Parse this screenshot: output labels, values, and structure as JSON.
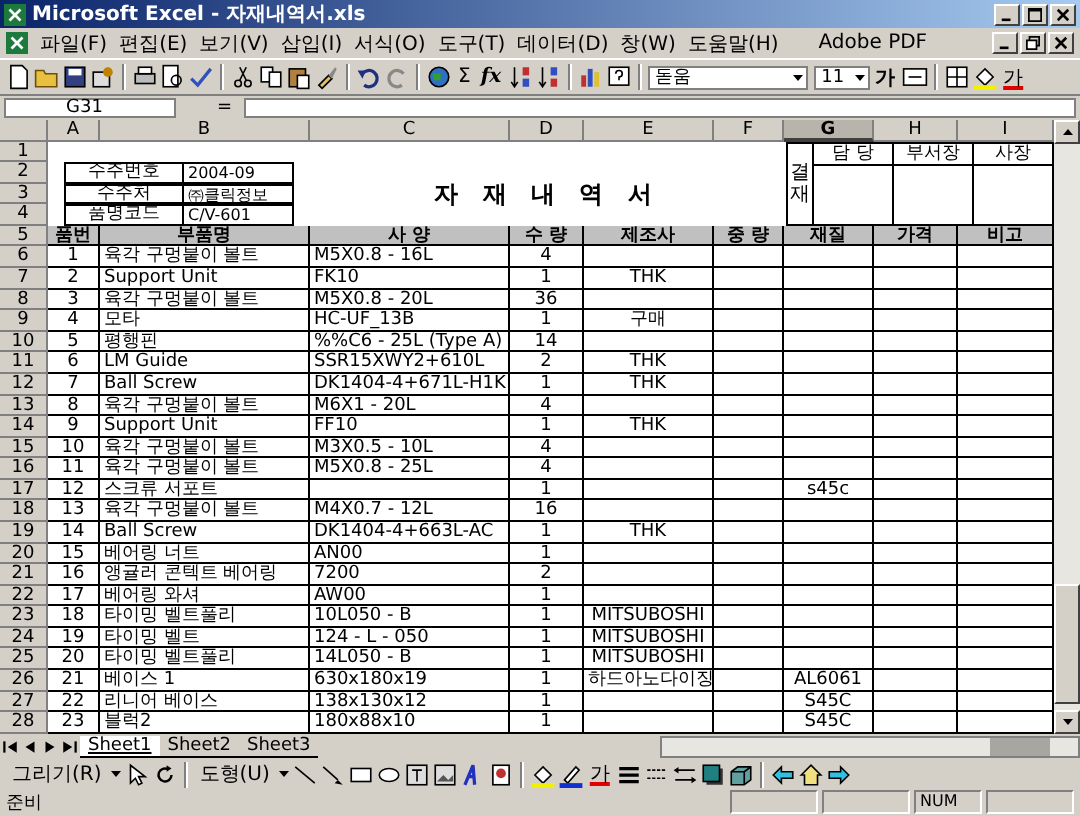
{
  "window": {
    "title": "Microsoft Excel - 자재내역서.xls"
  },
  "menu": [
    "파일(F)",
    "편집(E)",
    "보기(V)",
    "삽입(I)",
    "서식(O)",
    "도구(T)",
    "데이터(D)",
    "창(W)",
    "도움말(H)",
    "Adobe PDF"
  ],
  "toolbar": {
    "sum": "Σ",
    "function": "fx",
    "font": "돋움",
    "size": "11",
    "bold": "가",
    "font_color": "가"
  },
  "formula_bar": {
    "name_box": "G31",
    "equals": "="
  },
  "columns": [
    {
      "label": "A",
      "selected": false
    },
    {
      "label": "B",
      "selected": false
    },
    {
      "label": "C",
      "selected": false
    },
    {
      "label": "D",
      "selected": false
    },
    {
      "label": "E",
      "selected": false
    },
    {
      "label": "F",
      "selected": false
    },
    {
      "label": "G",
      "selected": true
    },
    {
      "label": "H",
      "selected": false
    },
    {
      "label": "I",
      "selected": false
    }
  ],
  "row_headers": [
    "1",
    "2",
    "3",
    "4",
    "5",
    "6",
    "7",
    "8",
    "9",
    "10",
    "11",
    "12",
    "13",
    "14",
    "15",
    "16",
    "17",
    "18",
    "19",
    "20",
    "21",
    "22",
    "23",
    "24",
    "25",
    "26",
    "27",
    "28"
  ],
  "header_block": {
    "fields": [
      {
        "label": "수주번호",
        "value": "2004-09"
      },
      {
        "label": "수주처",
        "value": "㈜클릭정보"
      },
      {
        "label": "품명코드",
        "value": "C/V-601"
      }
    ],
    "title": "자 재 내 역 서",
    "approval": {
      "label": "결재",
      "roles": [
        "담 당",
        "부서장",
        "사장"
      ]
    }
  },
  "table": {
    "columns": [
      "품번",
      "부품명",
      "사 양",
      "수 량",
      "제조사",
      "중 량",
      "재질",
      "가격",
      "비고"
    ],
    "rows": [
      {
        "no": "1",
        "part": "육각 구멍붙이 볼트",
        "spec": "M5X0.8 - 16L",
        "qty": "4"
      },
      {
        "no": "2",
        "part": "Support Unit",
        "spec": "FK10",
        "qty": "1",
        "maker": "THK"
      },
      {
        "no": "3",
        "part": "육각 구멍붙이 볼트",
        "spec": "M5X0.8 - 20L",
        "qty": "36"
      },
      {
        "no": "4",
        "part": "모타",
        "spec": "HC-UF_13B",
        "qty": "1",
        "maker": "구매"
      },
      {
        "no": "5",
        "part": "평행핀",
        "spec": "%%C6 - 25L (Type A)",
        "qty": "14"
      },
      {
        "no": "6",
        "part": "LM Guide",
        "spec": "SSR15XWY2+610L",
        "qty": "2",
        "maker": "THK"
      },
      {
        "no": "7",
        "part": "Ball Screw",
        "spec": "DK1404-4+671L-H1K",
        "qty": "1",
        "maker": "THK"
      },
      {
        "no": "8",
        "part": "육각 구멍붙이 볼트",
        "spec": "M6X1 - 20L",
        "qty": "4"
      },
      {
        "no": "9",
        "part": "Support Unit",
        "spec": "FF10",
        "qty": "1",
        "maker": "THK"
      },
      {
        "no": "10",
        "part": "육각 구멍붙이 볼트",
        "spec": "M3X0.5 - 10L",
        "qty": "4"
      },
      {
        "no": "11",
        "part": "육각 구멍붙이 볼트",
        "spec": "M5X0.8 - 25L",
        "qty": "4"
      },
      {
        "no": "12",
        "part": "스크류 서포트",
        "qty": "1",
        "material": "s45c"
      },
      {
        "no": "13",
        "part": "육각 구멍붙이 볼트",
        "spec": "M4X0.7 - 12L",
        "qty": "16"
      },
      {
        "no": "14",
        "part": "Ball Screw",
        "spec": "DK1404-4+663L-AC",
        "qty": "1",
        "maker": "THK"
      },
      {
        "no": "15",
        "part": "베어링 너트",
        "spec": "AN00",
        "qty": "1"
      },
      {
        "no": "16",
        "part": "앵귤러 콘텍트 베어링",
        "spec": "7200",
        "qty": "2"
      },
      {
        "no": "17",
        "part": "베어링 와셔",
        "spec": "AW00",
        "qty": "1"
      },
      {
        "no": "18",
        "part": "타이밍 벨트풀리",
        "spec": "10L050 -  B",
        "qty": "1",
        "maker": "MITSUBOSHI"
      },
      {
        "no": "19",
        "part": "타이밍 벨트",
        "spec": "124 - L - 050",
        "qty": "1",
        "maker": "MITSUBOSHI"
      },
      {
        "no": "20",
        "part": "타이밍 벨트풀리",
        "spec": "14L050 -  B",
        "qty": "1",
        "maker": "MITSUBOSHI"
      },
      {
        "no": "21",
        "part": "베이스 1",
        "spec": "630x180x19",
        "qty": "1",
        "maker": "하드아노다이징",
        "material": "AL6061"
      },
      {
        "no": "22",
        "part": "리니어 베이스",
        "spec": "138x130x12",
        "qty": "1",
        "material": "S45C"
      },
      {
        "no": "23",
        "part": "블럭2",
        "spec": "180x88x10",
        "qty": "1",
        "material": "S45C"
      }
    ]
  },
  "sheet_tabs": [
    {
      "label": "Sheet1",
      "selected": true
    },
    {
      "label": "Sheet2",
      "selected": false
    },
    {
      "label": "Sheet3",
      "selected": false
    }
  ],
  "drawing_toolbar": {
    "draw": "그리기(R)",
    "shapes": "도형(U)",
    "font_color": "가"
  },
  "status_bar": {
    "mode": "준비",
    "num": "NUM"
  }
}
